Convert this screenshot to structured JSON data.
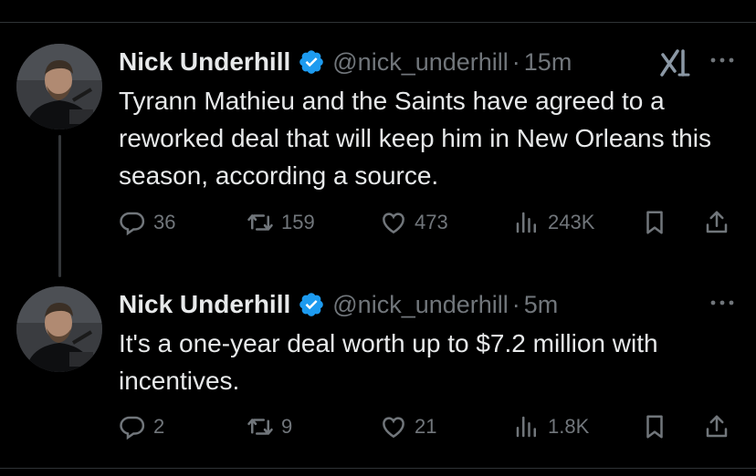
{
  "tweets": [
    {
      "author": {
        "name": "Nick Underhill",
        "handle": "@nick_underhill"
      },
      "separator": "·",
      "time": "15m",
      "text": "Tyrann Mathieu and the Saints have agreed to a reworked deal that will keep him in New Orleans this season, according a source.",
      "metrics": {
        "replies": "36",
        "reposts": "159",
        "likes": "473",
        "views": "243K"
      },
      "show_grok_icon": true
    },
    {
      "author": {
        "name": "Nick Underhill",
        "handle": "@nick_underhill"
      },
      "separator": "·",
      "time": "5m",
      "text": "It's a one-year deal worth up to $7.2 million with incentives.",
      "metrics": {
        "replies": "2",
        "reposts": "9",
        "likes": "21",
        "views": "1.8K"
      },
      "show_grok_icon": false
    }
  ],
  "colors": {
    "background": "#000000",
    "text_primary": "#e7e9ea",
    "text_secondary": "#71767b",
    "verified_blue": "#1d9bf0",
    "divider": "#2f3336"
  }
}
